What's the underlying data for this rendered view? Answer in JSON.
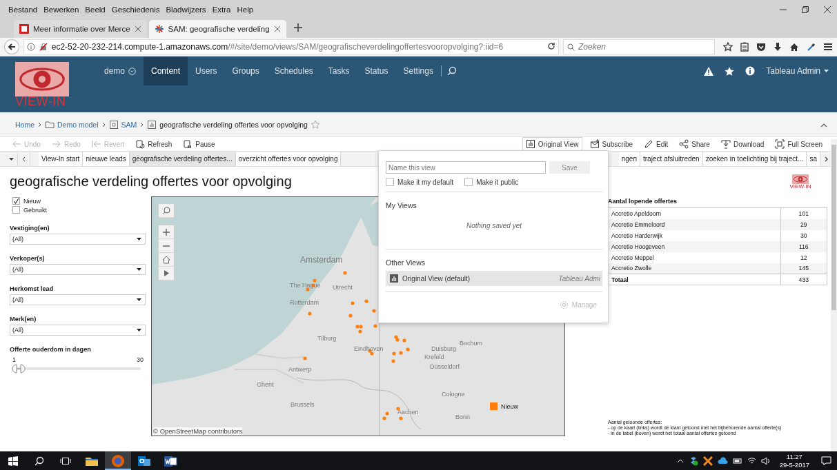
{
  "browser": {
    "menu": [
      "Bestand",
      "Bewerken",
      "Beeld",
      "Geschiedenis",
      "Bladwijzers",
      "Extra",
      "Help"
    ],
    "tabs": [
      {
        "title": "Meer informatie over Merce",
        "selected": false
      },
      {
        "title": "SAM: geografische verdeling",
        "selected": true
      }
    ],
    "url_host": "ec2-52-20-232-214.compute-1.amazonaws.com",
    "url_path": "/#/site/demo/views/SAM/geografischeverdelingoffertesvooropvolging?:iid=6",
    "search": {
      "placeholder": "Zoeken"
    }
  },
  "header": {
    "logo": "VIEW-IN",
    "site": "demo",
    "nav": [
      {
        "label": "Content",
        "selected": true
      },
      {
        "label": "Users",
        "selected": false
      },
      {
        "label": "Groups",
        "selected": false
      },
      {
        "label": "Schedules",
        "selected": false
      },
      {
        "label": "Tasks",
        "selected": false
      },
      {
        "label": "Status",
        "selected": false
      },
      {
        "label": "Settings",
        "selected": false
      }
    ],
    "user": "Tableau Admin"
  },
  "breadcrumb": [
    {
      "label": "Home",
      "kind": "home"
    },
    {
      "label": "Demo model",
      "kind": "project"
    },
    {
      "label": "SAM",
      "kind": "workbook"
    },
    {
      "label": "geografische verdeling offertes voor opvolging",
      "kind": "view"
    }
  ],
  "toolbar": {
    "left": [
      {
        "label": "Undo",
        "kind": "undo",
        "disabled": true
      },
      {
        "label": "Redo",
        "kind": "redo",
        "disabled": true
      },
      {
        "label": "Revert",
        "kind": "revert",
        "disabled": true
      },
      {
        "label": "Refresh",
        "kind": "refresh",
        "disabled": false
      },
      {
        "label": "Pause",
        "kind": "pause",
        "disabled": false
      }
    ],
    "right": [
      {
        "label": "Original View",
        "kind": "views",
        "selected": true
      },
      {
        "label": "Subscribe",
        "kind": "subscribe",
        "selected": false
      },
      {
        "label": "Edit",
        "kind": "edit",
        "selected": false
      },
      {
        "label": "Share",
        "kind": "share",
        "selected": false
      },
      {
        "label": "Download",
        "kind": "download",
        "selected": false
      },
      {
        "label": "Full Screen",
        "kind": "fullscreen",
        "selected": false
      }
    ]
  },
  "sheet_tabs": [
    {
      "label": "View-In start",
      "selected": false
    },
    {
      "label": "nieuwe leads",
      "selected": false
    },
    {
      "label": "geografische verdeling offertes...",
      "selected": true
    },
    {
      "label": "overzicht offertes voor opvolging",
      "selected": false
    },
    {
      "label": "ngen",
      "selected": false
    },
    {
      "label": "traject afsluitreden",
      "selected": false
    },
    {
      "label": "zoeken in toelichting bij traject...",
      "selected": false
    },
    {
      "label": "sa",
      "selected": false
    }
  ],
  "dashboard": {
    "title": "geografische verdeling offertes voor opvolging",
    "logo": "VIEW-IN",
    "type_filter": [
      {
        "label": "Nieuw",
        "checked": true
      },
      {
        "label": "Gebruikt",
        "checked": false
      }
    ],
    "filters": [
      {
        "label": "Vestiging(en)",
        "value": "(All)"
      },
      {
        "label": "Verkoper(s)",
        "value": "(All)"
      },
      {
        "label": "Herkomst lead",
        "value": "(All)"
      },
      {
        "label": "Merk(en)",
        "value": "(All)"
      }
    ],
    "slider": {
      "label": "Offerte ouderdom in dagen",
      "min": "1",
      "max": "30",
      "level": 0
    },
    "map": {
      "places": [
        "Amsterdam",
        "The Hague",
        "Utrecht",
        "Rotterdam",
        "Tilburg",
        "Eindhoven",
        "Bochum",
        "Duisburg",
        "Krefeld",
        "Düsseldorf",
        "Antwerp",
        "Ghent",
        "Brussels",
        "Cologne",
        "Aachen",
        "Bonn"
      ],
      "legend": "Nieuw",
      "attribution": "© OpenStreetMap contributors"
    },
    "table": {
      "title": "Aantal lopende offertes",
      "rows": [
        {
          "name": "Accretio Apeldoorn",
          "value": "101"
        },
        {
          "name": "Accretio Emmeloord",
          "value": "29"
        },
        {
          "name": "Accretio Harderwijk",
          "value": "30"
        },
        {
          "name": "Accretio Hoogeveen",
          "value": "116"
        },
        {
          "name": "Accretio Meppel",
          "value": "12"
        },
        {
          "name": "Accretio Zwolle",
          "value": "145"
        }
      ],
      "total": {
        "name": "Totaal",
        "value": "433"
      }
    },
    "note": [
      "Aantal getoonde offertes:",
      "- op de kaart (links) wordt de klant getoond met het bijbehorende aantal offerte(s)",
      "- in de tabel (boven) wordt het totaal aantal offertes getoond"
    ]
  },
  "views_popup": {
    "name_field": {
      "placeholder": "Name this view"
    },
    "save": {
      "label": "Save",
      "disabled": true
    },
    "options": [
      {
        "label": "Make it my default",
        "checked": false
      },
      {
        "label": "Make it public",
        "checked": false
      }
    ],
    "my_views": {
      "title": "My Views",
      "empty": "Nothing saved yet"
    },
    "other_views": {
      "title": "Other Views",
      "items": [
        {
          "name": "Original View (default)",
          "owner": "Tableau Admi",
          "selected": true
        }
      ]
    },
    "manage": {
      "label": "Manage",
      "disabled": true
    }
  },
  "taskbar": {
    "apps": [
      {
        "kind": "explorer",
        "selected": false
      },
      {
        "kind": "firefox",
        "selected": true
      },
      {
        "kind": "outlook",
        "selected": false
      },
      {
        "kind": "word",
        "selected": false
      }
    ],
    "time": "11:27",
    "date": "29-5-2017"
  }
}
